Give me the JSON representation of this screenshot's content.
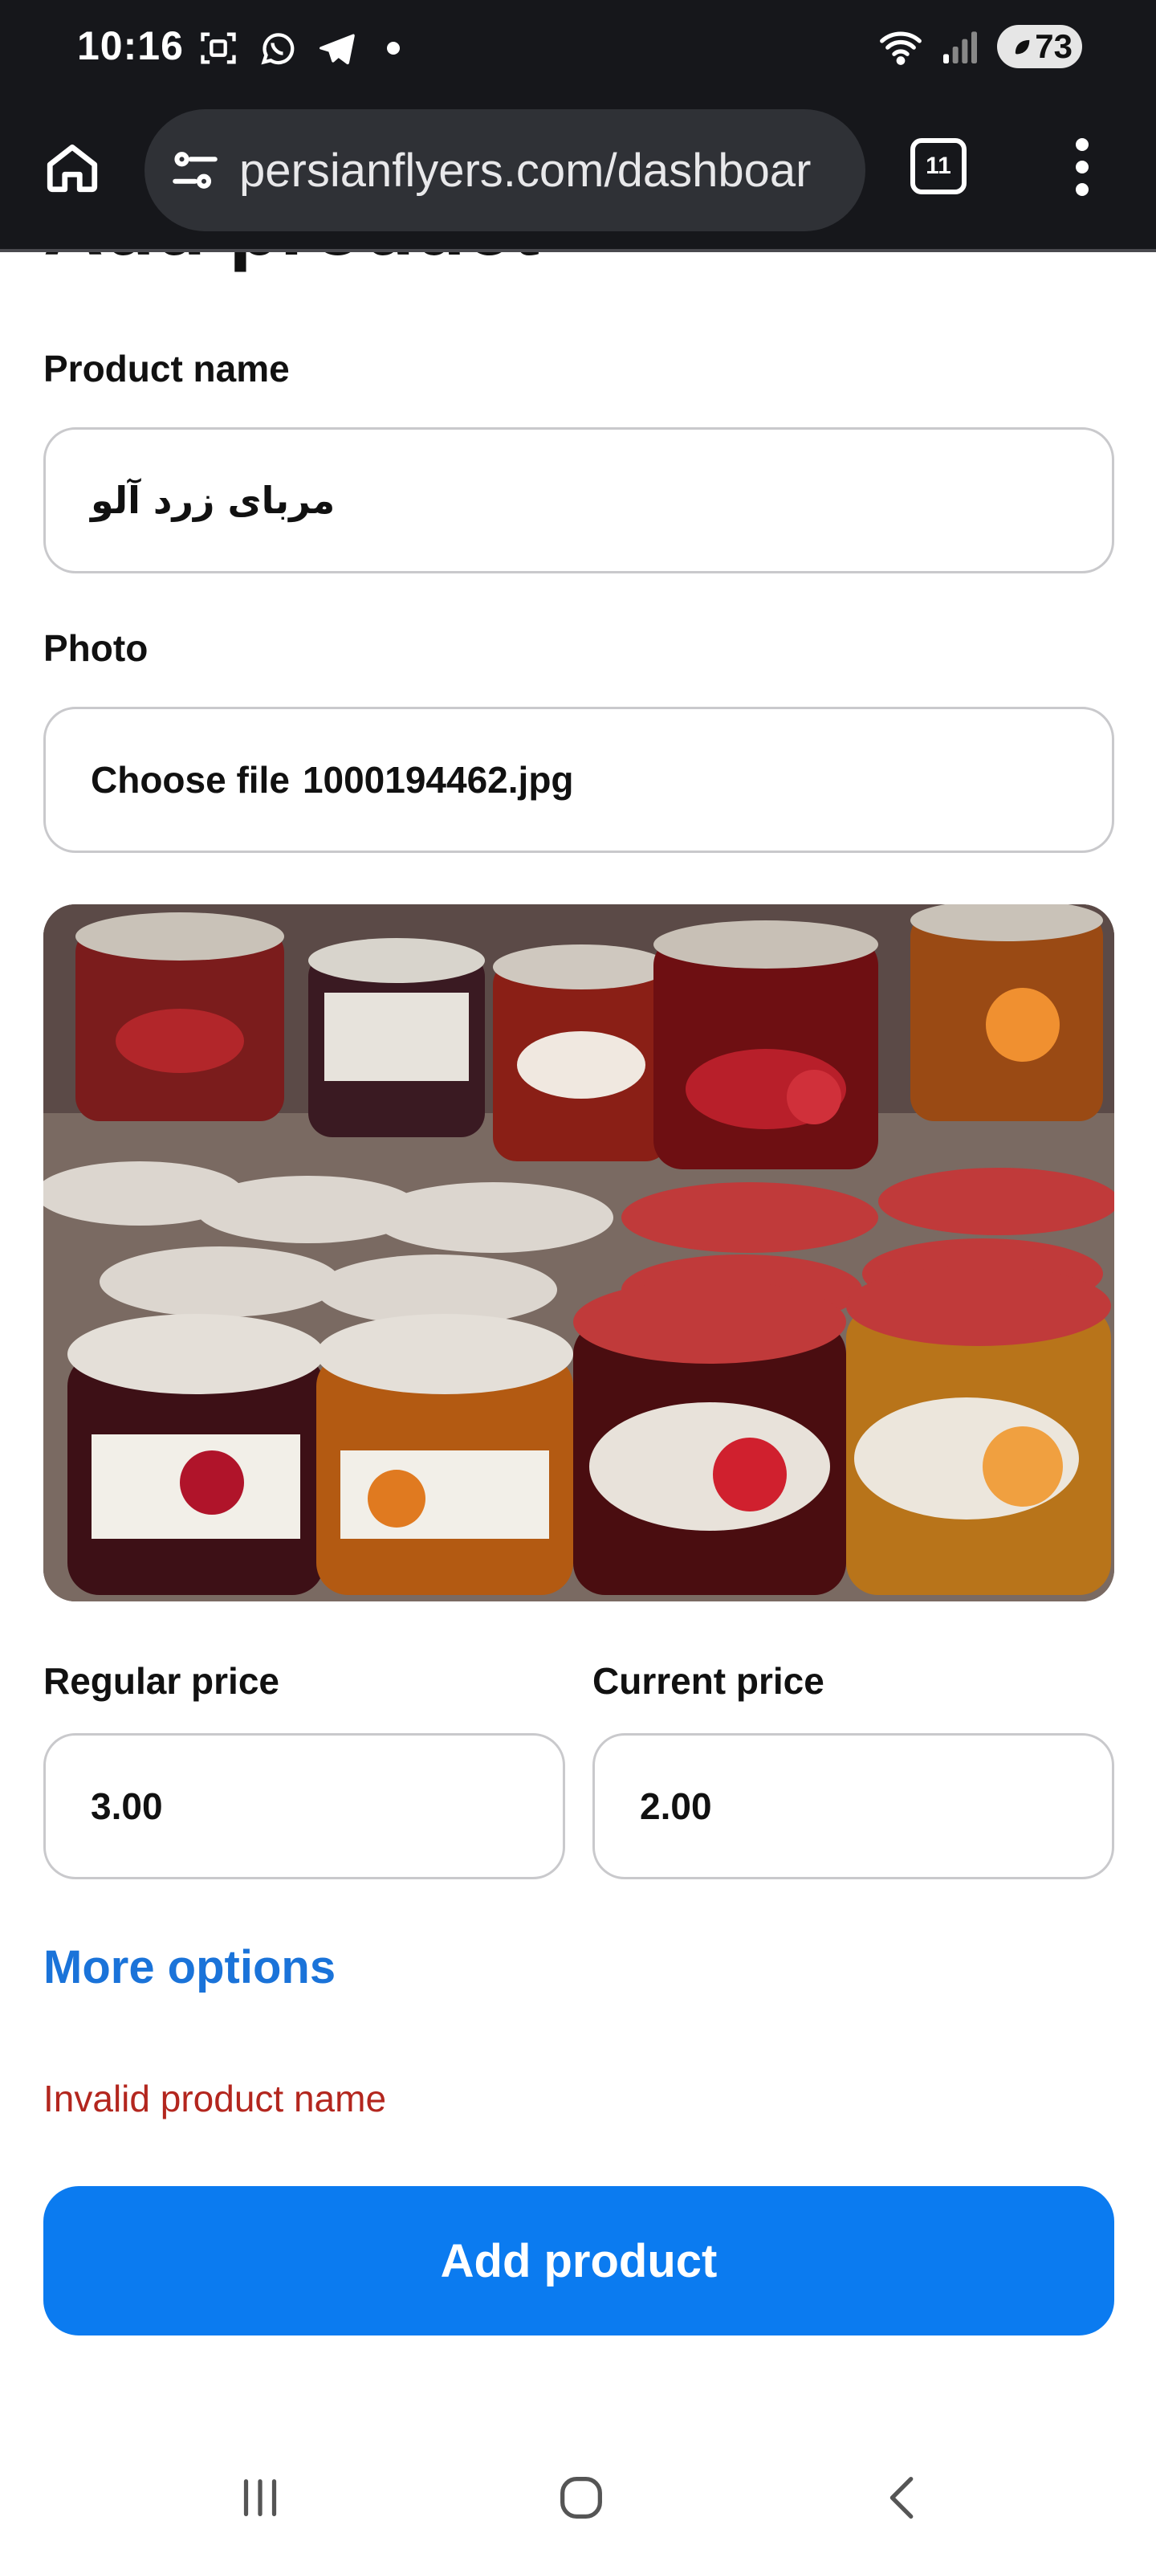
{
  "status_bar": {
    "time": "10:16",
    "battery": "73",
    "icons": [
      "screenshot-icon",
      "whatsapp-icon",
      "telegram-icon",
      "notification-dot",
      "wifi-icon",
      "signal-icon",
      "battery-icon"
    ]
  },
  "browser": {
    "url": "persianflyers.com/dashboar",
    "tab_count": "11",
    "icons": [
      "home-icon",
      "site-settings-icon",
      "tabs-icon",
      "more-menu-icon"
    ]
  },
  "form": {
    "heading": "Add product",
    "product_name_label": "Product name",
    "product_name_value": "مربای زرد آلو",
    "photo_label": "Photo",
    "photo_button": "Choose file",
    "photo_filename": "1000194462.jpg",
    "regular_price_label": "Regular price",
    "regular_price_value": "3.00",
    "current_price_label": "Current price",
    "current_price_value": "2.00",
    "more_options": "More options",
    "error_message": "Invalid product name",
    "submit_label": "Add product"
  },
  "colors": {
    "primary": "#0b7bf0",
    "link": "#1a73d9",
    "error": "#b3261e",
    "chrome_dark": "#16171b"
  },
  "nav_bar": {
    "icons": [
      "recents-icon",
      "home-circle-icon",
      "back-icon"
    ]
  }
}
